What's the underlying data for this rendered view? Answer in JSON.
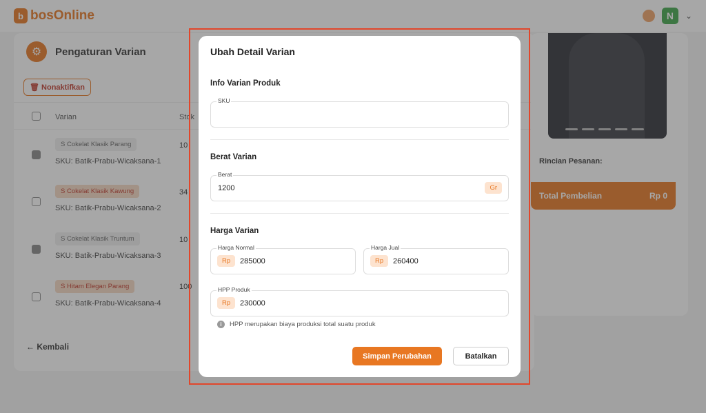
{
  "app": {
    "logo": "bosOnline",
    "logo_mark": "b",
    "avatar_initial": "N"
  },
  "left_panel": {
    "title": "Pengaturan Varian",
    "deactivate_label": "Nonaktifkan",
    "col_varian": "Varian",
    "col_stok": "Stok",
    "rows": [
      {
        "variant": "S Cokelat Klasik Parang",
        "sku": "SKU: Batik-Prabu-Wicaksana-1",
        "stock": "10",
        "checked": true
      },
      {
        "variant": "S Cokelat Klasik Kawung",
        "sku": "SKU: Batik-Prabu-Wicaksana-2",
        "stock": "34",
        "checked": false
      },
      {
        "variant": "S Cokelat Klasik Truntum",
        "sku": "SKU: Batik-Prabu-Wicaksana-3",
        "stock": "10",
        "checked": true
      },
      {
        "variant": "S Hitam Elegan Parang",
        "sku": "SKU: Batik-Prabu-Wicaksana-4",
        "stock": "100",
        "checked": false
      }
    ],
    "back_label": "Kembali"
  },
  "right_panel": {
    "rincian_label": "Rincian Pesanan:",
    "total_label": "Total Pembelian",
    "total_value": "Rp 0"
  },
  "modal": {
    "title": "Ubah Detail Varian",
    "info_section": "Info Varian Produk",
    "sku_label": "SKU",
    "sku_value": "",
    "weight_section": "Berat Varian",
    "weight_label": "Berat",
    "weight_value": "1200",
    "weight_unit": "Gr",
    "price_section": "Harga Varian",
    "normal_price_label": "Harga Normal",
    "normal_price_value": "285000",
    "sell_price_label": "Harga Jual",
    "sell_price_value": "260400",
    "hpp_label": "HPP Produk",
    "hpp_value": "230000",
    "currency": "Rp",
    "hint": "HPP merupakan biaya produksi total suatu produk",
    "save_label": "Simpan Perubahan",
    "cancel_label": "Batalkan"
  },
  "colors": {
    "accent": "#e87722",
    "highlight": "#e2462a"
  }
}
